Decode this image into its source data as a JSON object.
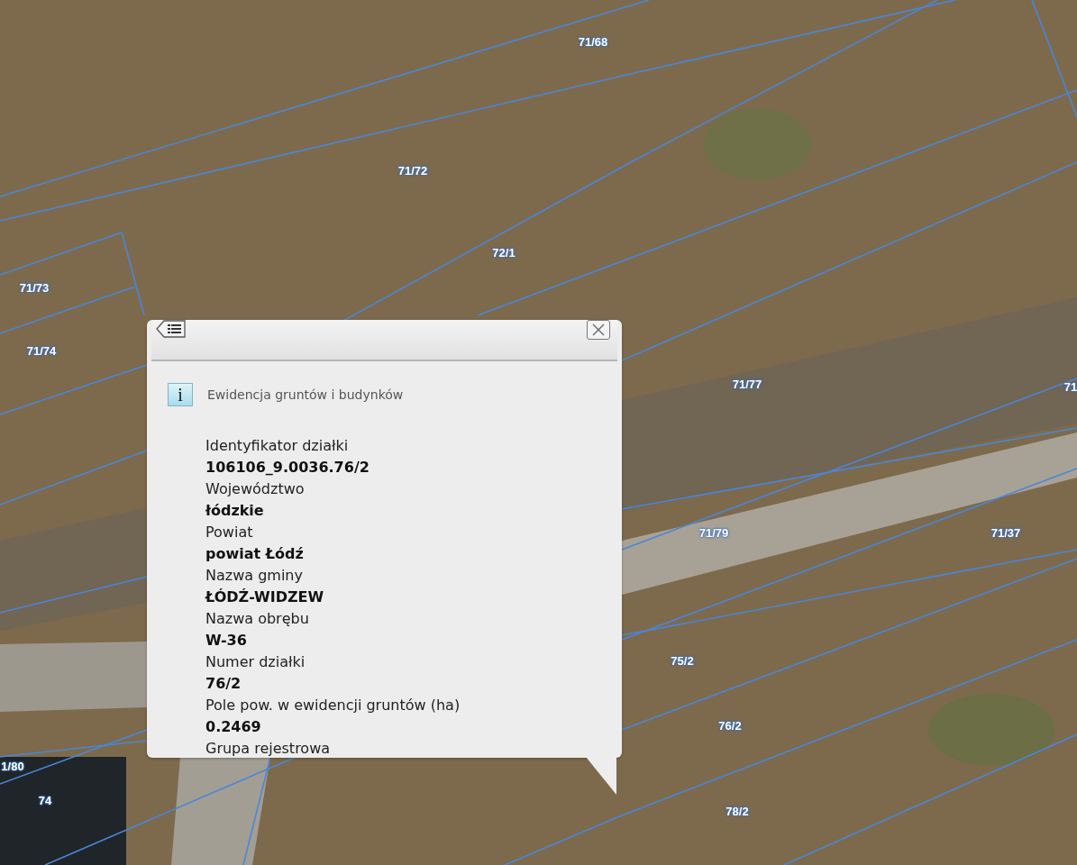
{
  "map": {
    "parcel_labels": [
      "71/68",
      "71/72",
      "72/1",
      "71/73",
      "71/74",
      "71/77",
      "71",
      "71/79",
      "71/37",
      "75/2",
      "76/2",
      "78/2",
      "1/80",
      "74"
    ]
  },
  "popup": {
    "info_icon": "i",
    "section_title": "Ewidencja gruntów i budynków",
    "fields": [
      {
        "label": "Identyfikator działki",
        "value": "106106_9.0036.76/2"
      },
      {
        "label": "Województwo",
        "value": "łódzkie"
      },
      {
        "label": "Powiat",
        "value": "powiat Łódź"
      },
      {
        "label": "Nazwa gminy",
        "value": "ŁÓDŹ-WIDZEW"
      },
      {
        "label": "Nazwa obrębu",
        "value": "W-36"
      },
      {
        "label": "Numer działki",
        "value": "76/2"
      },
      {
        "label": "Pole pow. w ewidencji gruntów (ha)",
        "value": "0.2469"
      },
      {
        "label": "Grupa rejestrowa"
      }
    ]
  }
}
